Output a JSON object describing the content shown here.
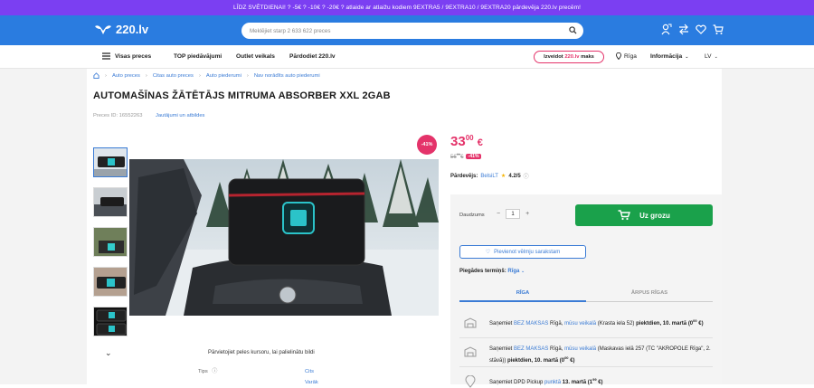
{
  "promo_text": "LĪDZ SVĒTDIENAI! ? -5€ ? -10€ ? -20€ ? atlaide ar atlaižu kodiem 9EXTRA5 / 9EXTRA10 / 9EXTRA20 pārdevēja 220.lv precēm!",
  "logo_text": "220.lv",
  "search": {
    "placeholder": "Meklējiet starp 2 633 622 preces"
  },
  "nav": {
    "all": "Visas preces",
    "top": "TOP piedāvājumi",
    "outlet": "Outlet veikals",
    "sell": "Pārdodiet 220.lv",
    "create_pre": "Izveidot",
    "create_brand": "220.lv",
    "create_post": "maks",
    "city": "Rīga",
    "info": "Informācija",
    "lang": "LV"
  },
  "breadcrumbs": [
    "Auto preces",
    "Citas auto preces",
    "Auto piederumi",
    "Nav norādīts auto piederumi"
  ],
  "product": {
    "title": "AUTOMAŠĪNAS ŽĀTĒTĀJS MITRUMA ABSORBER XXL 2GAB",
    "id_label": "Preces ID: 16552263",
    "qa_link": "Jautājumi un atbildes",
    "discount_badge": "-41%",
    "hover_hint": "Pārvietojiet peles kursoru, lai palielinātu bildi",
    "spec_label": "Tips",
    "spec_values": [
      "Cits",
      "Varāk"
    ]
  },
  "price": {
    "int": "33",
    "dec": "00",
    "cur": "€",
    "old_int": "56",
    "old_dec": "01",
    "old_cur": "€",
    "badge": "-41%"
  },
  "seller": {
    "label": "Pārdevējs:",
    "name": "BelsiLT",
    "rating": "4.2/5"
  },
  "buy": {
    "qty_label": "Daudzums",
    "qty_minus": "−",
    "qty_value": "1",
    "qty_plus": "+",
    "cart_label": "Uz grozu",
    "wishlist": "Pievienot vēlmju sarakstam",
    "delivery_label": "Piegādes termiņš:",
    "delivery_city": "Rīga",
    "tab1": "RĪGA",
    "tab2": "ĀRPUS RĪGAS"
  },
  "pickup": [
    {
      "pre": "Saņemiet",
      "free": "BEZ MAKSAS",
      "mid": "Rīgā,",
      "shop": "mūsu veikalā",
      "addr": "(Krasta iela 52)",
      "day": "piektdien, 10. martā",
      "price": "(0",
      "price_sup": "00",
      "price_end": "€)"
    },
    {
      "pre": "Saņemiet",
      "free": "BEZ MAKSAS",
      "mid": "Rīgā,",
      "shop": "mūsu veikalā",
      "addr": "(Maskavas ielā 257 (TC \"AKROPOLE Rīga\", 2. stāvā))",
      "day": "piektdien, 10. martā",
      "price": "(0",
      "price_sup": "00",
      "price_end": "€)"
    },
    {
      "pre": "Saņemiet DPD Pickup",
      "point": "punktā",
      "day": "13. martā",
      "price": "(1",
      "price_sup": "99",
      "price_end": "€)"
    }
  ],
  "colors": {
    "promo": "#7b3ff2",
    "header": "#2a7ce0",
    "accent": "#e4336a",
    "cta": "#1aa14b",
    "link": "#3a7bd5"
  }
}
